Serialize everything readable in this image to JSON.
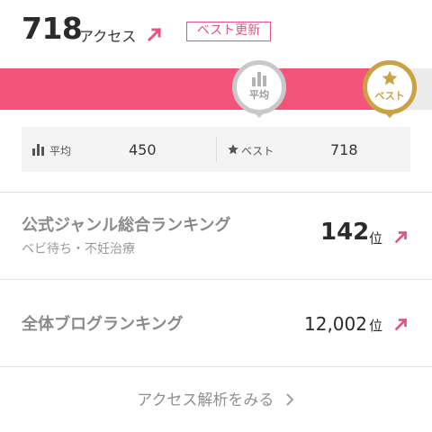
{
  "access": {
    "count": "718",
    "unit": "アクセス",
    "trend_icon": "arrow-up-right-icon",
    "best_badge": "ベスト更新"
  },
  "meter": {
    "fill_fraction": 0.9,
    "average_marker": "平均",
    "best_marker": "ベスト"
  },
  "stats": {
    "average_label": "平均",
    "average_value": "450",
    "best_label": "ベスト",
    "best_value": "718"
  },
  "rankings": [
    {
      "title": "公式ジャンル総合ランキング",
      "subtitle": "ベビ待ち・不妊治療",
      "rank": "142",
      "suffix": "位"
    },
    {
      "title": "全体ブログランキング",
      "rank": "12,002",
      "suffix": "位"
    }
  ],
  "link": {
    "label": "アクセス解析をみる"
  },
  "colors": {
    "accent": "#f4537a",
    "gold": "#c9a244",
    "gray": "#c9c9c9"
  }
}
